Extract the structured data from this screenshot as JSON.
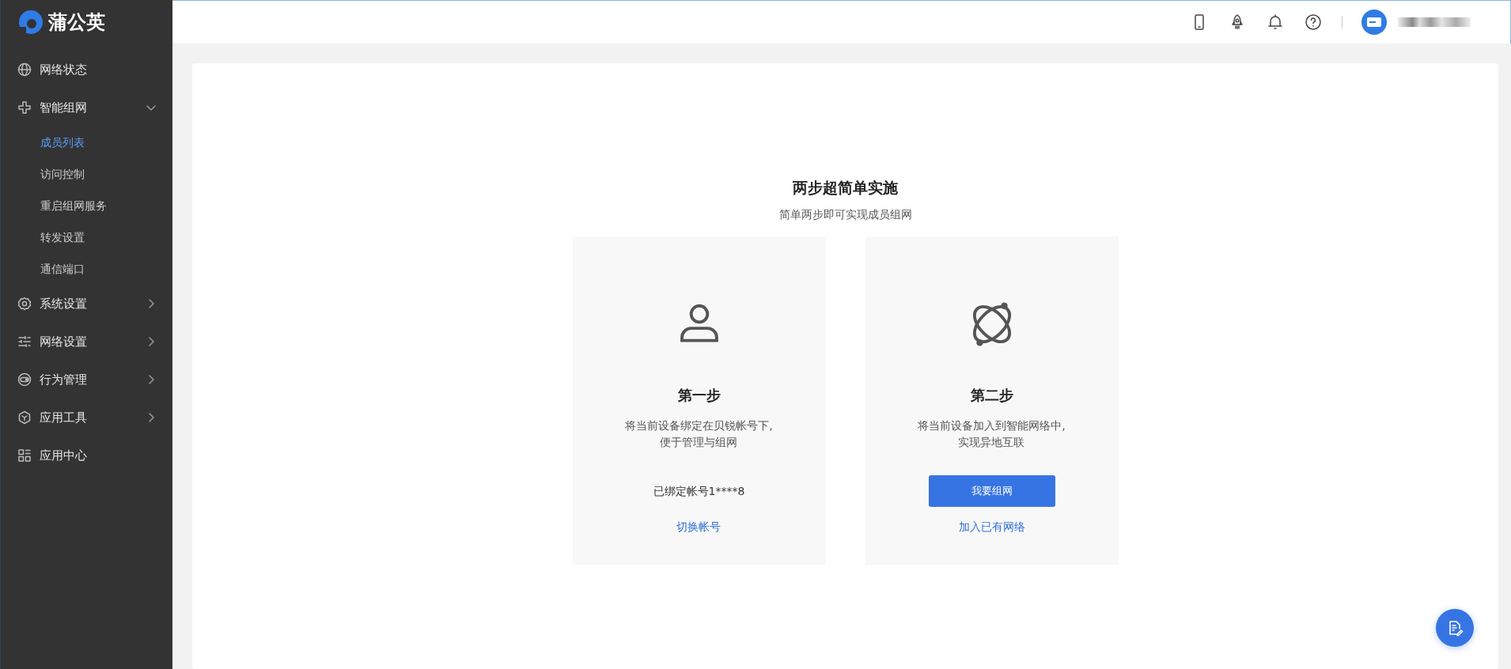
{
  "sidebar": {
    "logo": "蒲公英",
    "items": [
      {
        "kind": "link",
        "label": "网络状态"
      },
      {
        "kind": "group",
        "label": "智能组网",
        "expanded": true,
        "children": [
          {
            "label": "成员列表",
            "selected": true
          },
          {
            "label": "访问控制",
            "selected": false
          },
          {
            "label": "重启组网服务",
            "selected": false
          },
          {
            "label": "转发设置",
            "selected": false
          },
          {
            "label": "通信端口",
            "selected": false
          }
        ]
      },
      {
        "kind": "group",
        "label": "系统设置",
        "expanded": false
      },
      {
        "kind": "group",
        "label": "网络设置",
        "expanded": false
      },
      {
        "kind": "group",
        "label": "行为管理",
        "expanded": false
      },
      {
        "kind": "group",
        "label": "应用工具",
        "expanded": false
      },
      {
        "kind": "link",
        "label": "应用中心"
      }
    ]
  },
  "main": {
    "title": "两步超简单实施",
    "subtitle": "简单两步即可实现成员组网",
    "steps": [
      {
        "title": "第一步",
        "description": [
          "将当前设备绑定在贝锐帐号下,",
          "便于管理与组网"
        ],
        "actions": [
          {
            "kind": "text",
            "label": "已绑定帐号1****8"
          },
          {
            "kind": "link",
            "label": "切换帐号"
          }
        ]
      },
      {
        "title": "第二步",
        "description": [
          "将当前设备加入到智能网络中,",
          "实现异地互联"
        ],
        "actions": [
          {
            "kind": "button",
            "label": "我要组网"
          },
          {
            "kind": "link",
            "label": "加入已有网络"
          }
        ]
      }
    ]
  }
}
